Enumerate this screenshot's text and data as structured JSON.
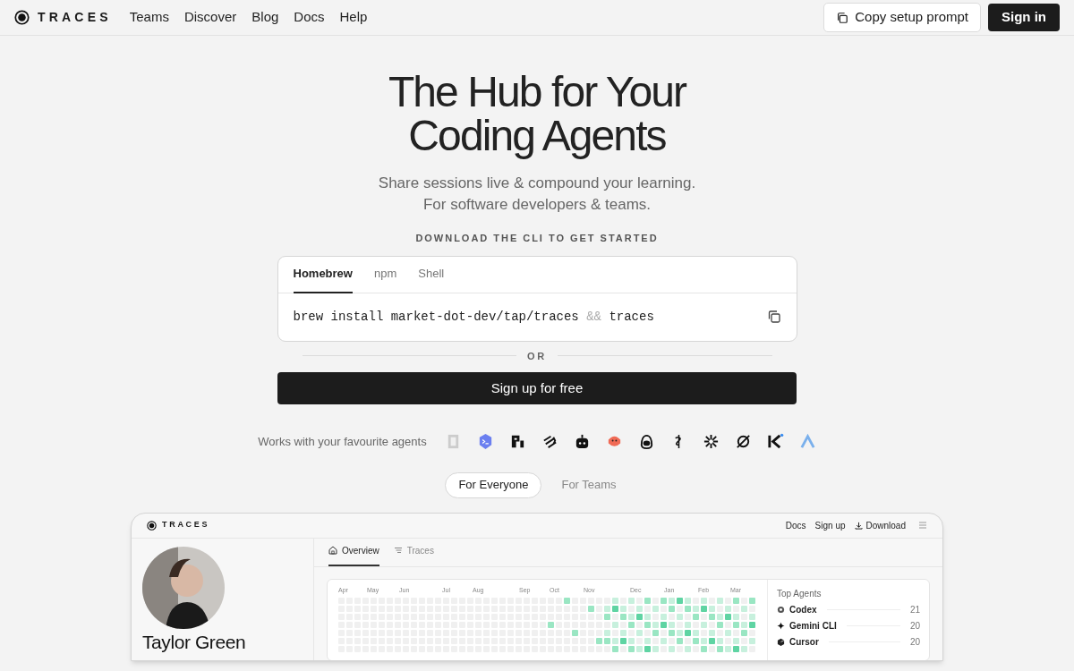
{
  "nav": {
    "brand": "TRACES",
    "links": [
      "Teams",
      "Discover",
      "Blog",
      "Docs",
      "Help"
    ],
    "copy_button": "Copy setup prompt",
    "sign_in": "Sign in"
  },
  "hero": {
    "title_lines": [
      "The Hub for Your",
      "Coding Agents"
    ],
    "subtitle_lines": [
      "Share sessions live & compound your learning.",
      "For software developers & teams."
    ]
  },
  "install": {
    "label": "DOWNLOAD THE CLI TO GET STARTED",
    "tabs": [
      {
        "label": "Homebrew",
        "selected": true
      },
      {
        "label": "npm",
        "selected": false
      },
      {
        "label": "Shell",
        "selected": false
      }
    ],
    "command_parts": [
      {
        "text": "brew install market-dot-dev/tap/traces",
        "muted": false
      },
      {
        "text": "&&",
        "muted": true
      },
      {
        "text": "traces",
        "muted": false
      }
    ]
  },
  "divider": "OR",
  "signup_button": "Sign up for free",
  "agents_label": "Works with your favourite agents",
  "audience_tabs": [
    {
      "label": "For Everyone",
      "selected": true
    },
    {
      "label": "For Teams",
      "selected": false
    }
  ],
  "preview": {
    "brand": "TRACES",
    "nav": [
      "Docs",
      "Sign up",
      "Download"
    ],
    "tabs": [
      {
        "label": "Overview",
        "selected": true
      },
      {
        "label": "Traces",
        "selected": false
      }
    ],
    "profile_name": "Taylor Green",
    "months": [
      "Apr",
      "May",
      "Jun",
      "Jul",
      "Aug",
      "Sep",
      "Oct",
      "Nov",
      "Dec",
      "Jan",
      "Feb",
      "Mar"
    ],
    "top_agents": {
      "title": "Top Agents",
      "items": [
        {
          "name": "Codex",
          "count": "21"
        },
        {
          "name": "Gemini CLI",
          "count": "20"
        },
        {
          "name": "Cursor",
          "count": "20"
        }
      ]
    }
  }
}
